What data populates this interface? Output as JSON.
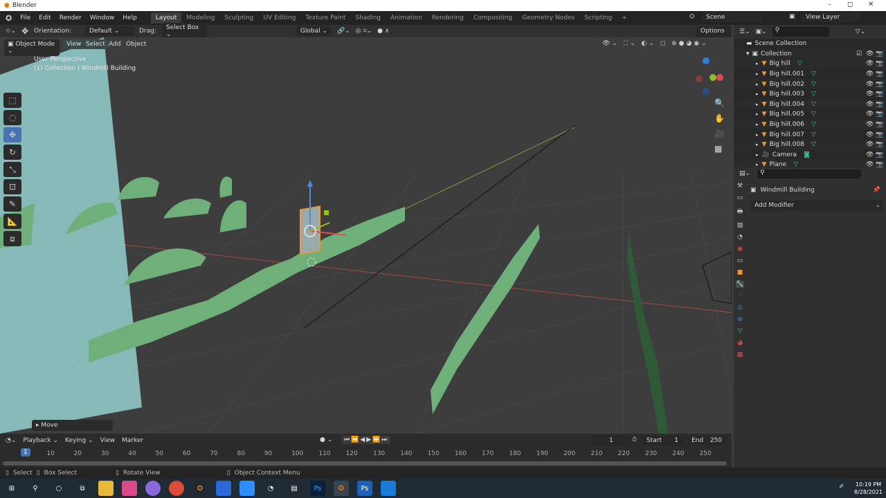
{
  "window": {
    "title": "Blender",
    "minimize": "–",
    "maximize": "◻",
    "close": "✕"
  },
  "menu": [
    "File",
    "Edit",
    "Render",
    "Window",
    "Help"
  ],
  "workspaces": [
    "Layout",
    "Modeling",
    "Sculpting",
    "UV Editing",
    "Texture Paint",
    "Shading",
    "Animation",
    "Rendering",
    "Compositing",
    "Geometry Nodes",
    "Scripting",
    "+"
  ],
  "scene": {
    "label": "Scene",
    "view_layer": "View Layer"
  },
  "tool_header": {
    "orientation_label": "Orientation:",
    "orientation_value": "Default",
    "drag_label": "Drag:",
    "drag_value": "Select Box",
    "transform_orientation": "Global",
    "options": "Options"
  },
  "viewport": {
    "mode": "Object Mode",
    "menus": [
      "View",
      "Select",
      "Add",
      "Object"
    ],
    "perspective": "User Perspective",
    "context": "(1) Collection | Windmill Building",
    "last_op": "Move"
  },
  "outliner": {
    "root": "Scene Collection",
    "collection": "Collection",
    "items": [
      "Big hill",
      "Big hill.001",
      "Big hill.002",
      "Big hill.003",
      "Big hill.004",
      "Big hill.005",
      "Big hill.006",
      "Big hill.007",
      "Big hill.008",
      "Camera",
      "Plane"
    ]
  },
  "properties": {
    "object": "Windmill Building",
    "add_modifier": "Add Modifier"
  },
  "timeline": {
    "menus": [
      "Playback",
      "Keying",
      "View",
      "Marker"
    ],
    "current_frame": "1",
    "start_label": "Start",
    "start": "1",
    "end_label": "End",
    "end": "250",
    "ticks": [
      "10",
      "20",
      "30",
      "40",
      "50",
      "60",
      "70",
      "80",
      "90",
      "100",
      "110",
      "120",
      "130",
      "140",
      "150",
      "160",
      "170",
      "180",
      "190",
      "200",
      "210",
      "220",
      "230",
      "240",
      "250"
    ],
    "playhead": "1"
  },
  "status": {
    "select": "Select",
    "box_select": "Box Select",
    "rotate": "Rotate View",
    "context_menu": "Object Context Menu"
  },
  "taskbar": {
    "time": "10:19 PM",
    "date": "8/28/2021",
    "apps": [
      "Ps",
      "Ps"
    ]
  },
  "colors": {
    "accent": "#4772b3",
    "hill": "#6fb07a",
    "plane": "#8fc7c7",
    "object": "#e99a3c",
    "mesh": "#3fbf9f"
  }
}
